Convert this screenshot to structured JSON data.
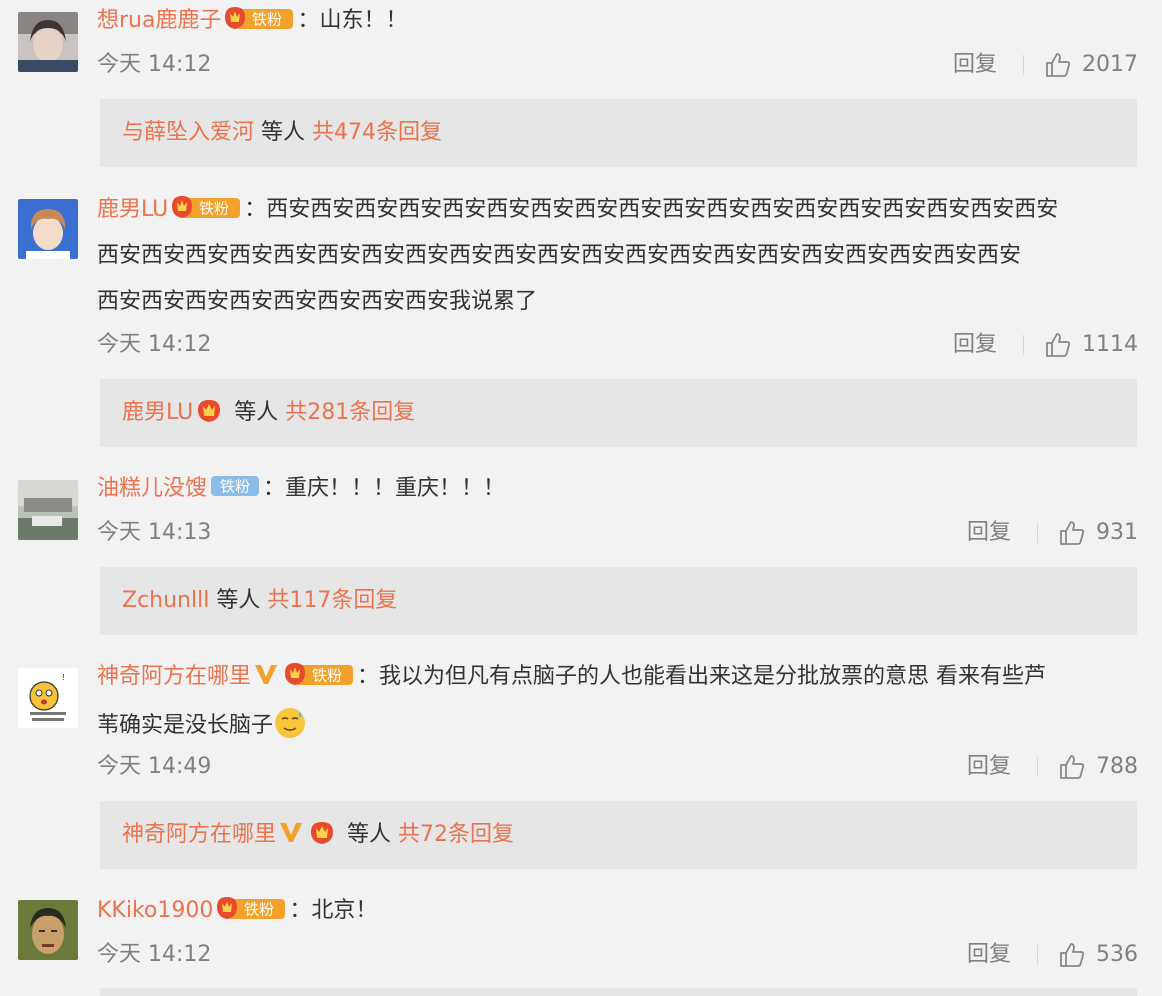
{
  "colors": {
    "accent": "#eb7350",
    "meta": "#808080",
    "subBg": "#e6e6e6",
    "pageBg": "#f2f2f2"
  },
  "comments": [
    {
      "avatar": "avatar-portrait",
      "username": "想rua鹿鹿子",
      "badge": "铁粉",
      "colon": "：",
      "text": "山东！！",
      "time": "今天 14:12",
      "reply_label": "回复",
      "likes": "2017",
      "sub": {
        "user": "与薛坠入爱河",
        "middle": " 等人 ",
        "count": "共474条回复"
      }
    },
    {
      "avatar": "avatar-boy",
      "username": "鹿男LU",
      "badge": "铁粉",
      "colon": "：",
      "text_line1": "西安西安西安西安西安西安西安西安西安西安西安西安西安西安西安西安西安西安",
      "text_line2": "西安西安西安西安西安西安西安西安西安西安西安西安西安西安西安西安西安西安西安西安西安",
      "text_line3": "西安西安西安西安西安西安西安西安我说累了",
      "time": "今天 14:12",
      "reply_label": "回复",
      "likes": "1114",
      "sub": {
        "user": "鹿男LU",
        "middle": " 等人 ",
        "count": "共281条回复"
      }
    },
    {
      "avatar": "avatar-scene",
      "username": "油糕儿没馊",
      "badge": "铁粉",
      "colon": "：",
      "text": "重庆！！！重庆！！！",
      "time": "今天 14:13",
      "reply_label": "回复",
      "likes": "931",
      "sub": {
        "user": "Zchunlll",
        "middle": " 等人 ",
        "count": "共117条回复"
      }
    },
    {
      "avatar": "avatar-meme",
      "username": "神奇阿方在哪里",
      "badge": "铁粉",
      "colon": "：",
      "text_line1": "我以为但凡有点脑子的人也能看出来这是分批放票的意思 看来有些芦",
      "text_line2": "苇确实是没长脑子",
      "time": "今天 14:49",
      "reply_label": "回复",
      "likes": "788",
      "sub": {
        "user": "神奇阿方在哪里",
        "middle": " 等人 ",
        "count": "共72条回复"
      }
    },
    {
      "avatar": "avatar-face",
      "username": "KKiko1900",
      "badge": "铁粉",
      "colon": "：",
      "text": "北京！",
      "time": "今天 14:12",
      "reply_label": "回复",
      "likes": "536"
    }
  ]
}
